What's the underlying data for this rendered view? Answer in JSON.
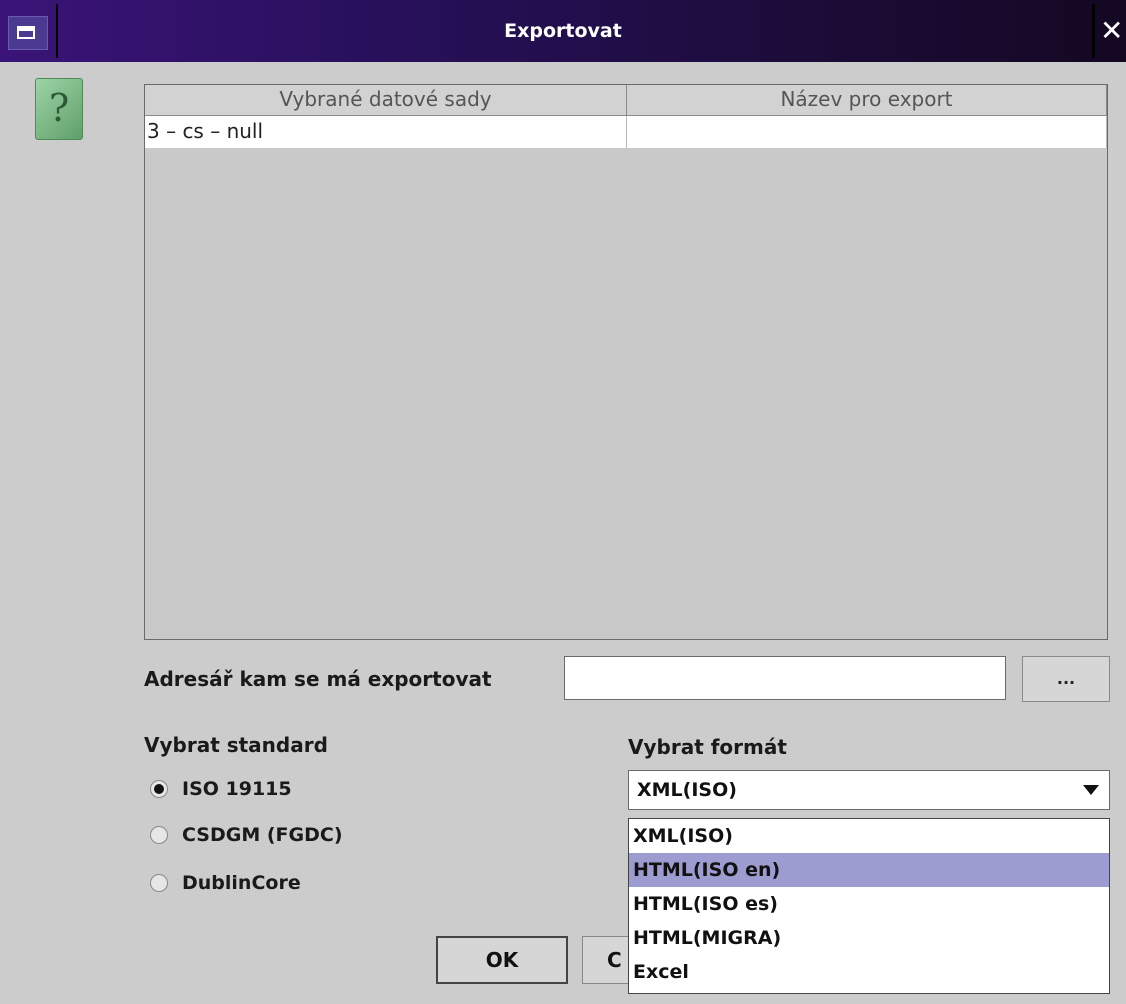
{
  "window": {
    "title": "Exportovat",
    "close_glyph": "✕"
  },
  "icons": {
    "window_menu": "window-menu-icon",
    "help": "question-mark-icon",
    "help_glyph": "?"
  },
  "table": {
    "columns": [
      "Vybrané datové sady",
      "Název pro export"
    ],
    "rows": [
      [
        "3 – cs – null",
        ""
      ]
    ]
  },
  "export_dir": {
    "label": "Adresář kam se má exportovat",
    "value": "",
    "browse_label": "..."
  },
  "standard": {
    "label": "Vybrat standard",
    "options": [
      "ISO 19115",
      "CSDGM (FGDC)",
      "DublinCore"
    ],
    "selected": "ISO 19115"
  },
  "format": {
    "label": "Vybrat formát",
    "selected_value": "XML(ISO)",
    "options": [
      "XML(ISO)",
      "HTML(ISO en)",
      "HTML(ISO es)",
      "HTML(MIGRA)",
      "Excel"
    ],
    "highlighted": "HTML(ISO en)"
  },
  "buttons": {
    "ok": "OK",
    "cancel_visible": "C"
  },
  "colors": {
    "desktop": "#3333a8",
    "dialog_bg": "#cccccc",
    "highlight": "#9c9cd0"
  }
}
